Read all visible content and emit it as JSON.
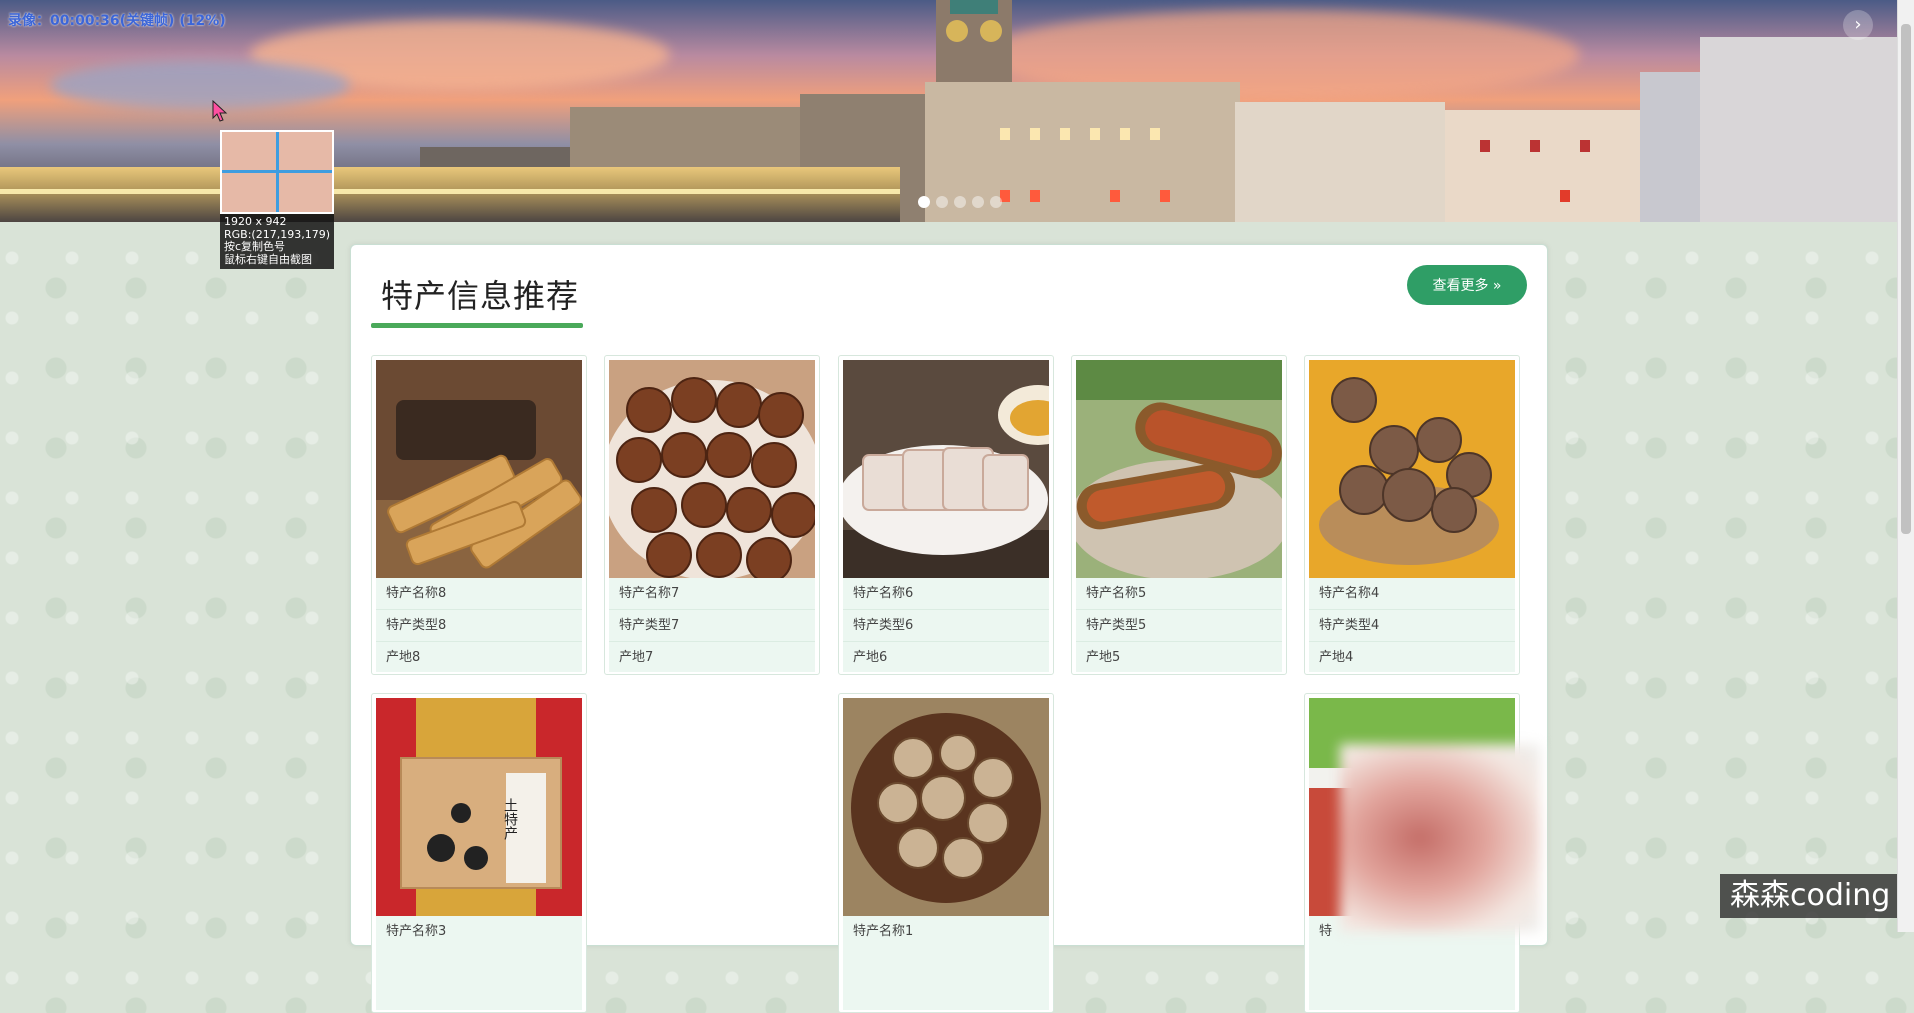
{
  "recorder": {
    "status": "录像：00:00:36(关键帧) (12%)"
  },
  "color_picker": {
    "size": "1920 x 942",
    "rgb": "RGB:(217,193,179)",
    "hint_copy": "按c复制色号",
    "hint_capture": "鼠标右键自由截图"
  },
  "banner": {
    "next_symbol": "›",
    "slide_count": 5,
    "active_slide": 1
  },
  "section": {
    "title": "特产信息推荐",
    "more_label": "查看更多 »"
  },
  "products": [
    {
      "name": "特产名称8",
      "type": "特产类型8",
      "origin": "产地8",
      "image": "sesame-candy-icon"
    },
    {
      "name": "特产名称7",
      "type": "特产类型7",
      "origin": "产地7",
      "image": "walnut-icon"
    },
    {
      "name": "特产名称6",
      "type": "特产类型6",
      "origin": "产地6",
      "image": "meat-slices-icon"
    },
    {
      "name": "特产名称5",
      "type": "特产类型5",
      "origin": "产地5",
      "image": "tamarind-icon"
    },
    {
      "name": "特产名称4",
      "type": "特产类型4",
      "origin": "产地4",
      "image": "monk-fruit-icon"
    },
    {
      "name": "特产名称3",
      "image": "gift-box-icon",
      "box_text": "土特产"
    },
    {
      "name": "特产名称1",
      "image": "shiitake-icon"
    },
    {
      "name": "特",
      "image": "cured-meat-icon"
    }
  ],
  "watermark": "森森coding",
  "colors": {
    "accent": "#2f9e66",
    "underline": "#4aa95a",
    "card_info_bg": "#ecf7f1",
    "page_bg": "#d9e3d7"
  }
}
